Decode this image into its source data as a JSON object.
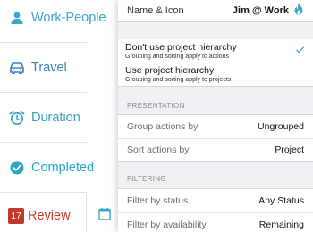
{
  "sidebar": {
    "items": [
      {
        "label": "Work-People",
        "icon": "person-icon"
      },
      {
        "label": "Travel",
        "icon": "car-icon"
      },
      {
        "label": "Duration",
        "icon": "alarm-clock-icon"
      },
      {
        "label": "Completed",
        "icon": "checkmark-circle-icon"
      },
      {
        "label": "Review",
        "icon": "review-badge",
        "badge": "17"
      }
    ],
    "next_icon": "calendar-icon",
    "colors": {
      "people": "#3aa6c9",
      "travel": "#3f7fbf",
      "review": "#c93a2a"
    }
  },
  "panel": {
    "name_icon": {
      "label": "Name & Icon",
      "value": "Jim @ Work",
      "icon": "flame-icon",
      "icon_color": "#3aa6c9"
    },
    "hierarchy_options": [
      {
        "title": "Don't use project hierarchy",
        "subtitle": "Grouping and sorting apply to actions",
        "selected": true
      },
      {
        "title": "Use project hierarchy",
        "subtitle": "Grouping and sorting apply to projects",
        "selected": false
      }
    ],
    "presentation": {
      "header": "PRESENTATION",
      "rows": [
        {
          "label": "Group actions by",
          "value": "Ungrouped"
        },
        {
          "label": "Sort actions by",
          "value": "Project"
        }
      ]
    },
    "filtering": {
      "header": "FILTERING",
      "rows": [
        {
          "label": "Filter by status",
          "value": "Any Status"
        },
        {
          "label": "Filter by availability",
          "value": "Remaining"
        }
      ]
    },
    "accent_color": "#3a8fd6"
  }
}
